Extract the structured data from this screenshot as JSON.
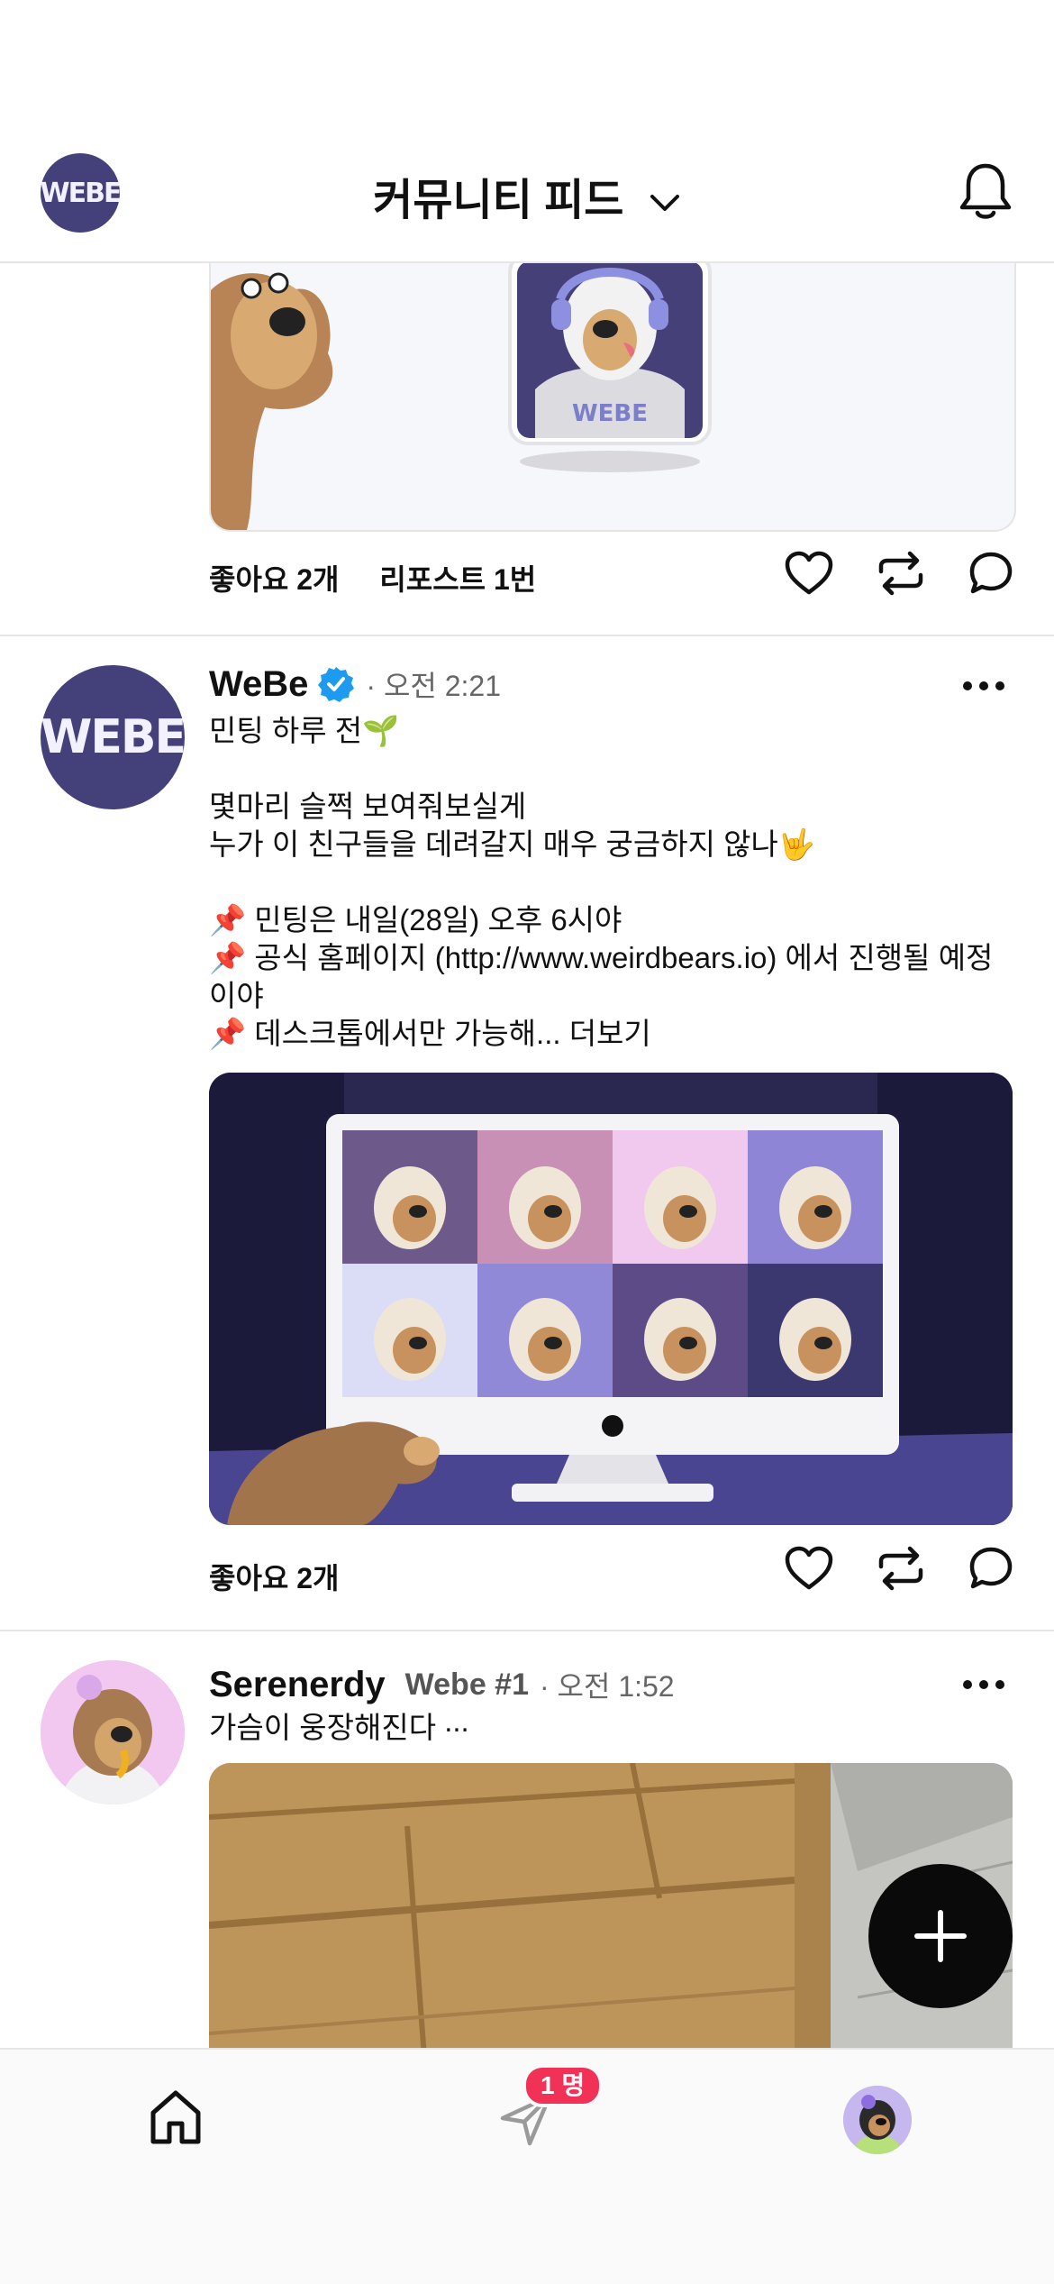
{
  "header": {
    "title": "커뮤니티 피드",
    "logo_text": "WEBE"
  },
  "posts": [
    {
      "likes_label": "좋아요 2개",
      "reposts_label": "리포스트 1번"
    },
    {
      "author": "WeBe",
      "time": "· 오전 2:21",
      "avatar_text": "WEBE",
      "body": [
        "민팅 하루 전🌱",
        "",
        "몇마리 슬쩍 보여줘보실게",
        "누가 이 친구들을 데려갈지 매우 궁금하지 않나🤟",
        "",
        "📌 민팅은 내일(28일) 오후 6시야",
        "📌 공식 홈페이지 (http://www.weirdbears.io) 에서 진행될 예정이야",
        "📌 데스크톱에서만 가능해... 더보기"
      ],
      "likes_label": "좋아요 2개"
    },
    {
      "author": "Serenerdy",
      "handle": "Webe #1",
      "time": "· 오전 1:52",
      "body": "가슴이 웅장해진다 ∙∙∙"
    }
  ],
  "tabbar": {
    "badge": "1 명"
  },
  "colors": {
    "brand_purple": "#44407a",
    "badge_red": "#f23157",
    "verified_blue": "#1d9bf0"
  },
  "icons": [
    "chevron-down-icon",
    "bell-icon",
    "heart-icon",
    "repost-icon",
    "comment-icon",
    "more-icon",
    "verified-icon",
    "plus-icon",
    "home-icon",
    "send-icon"
  ]
}
